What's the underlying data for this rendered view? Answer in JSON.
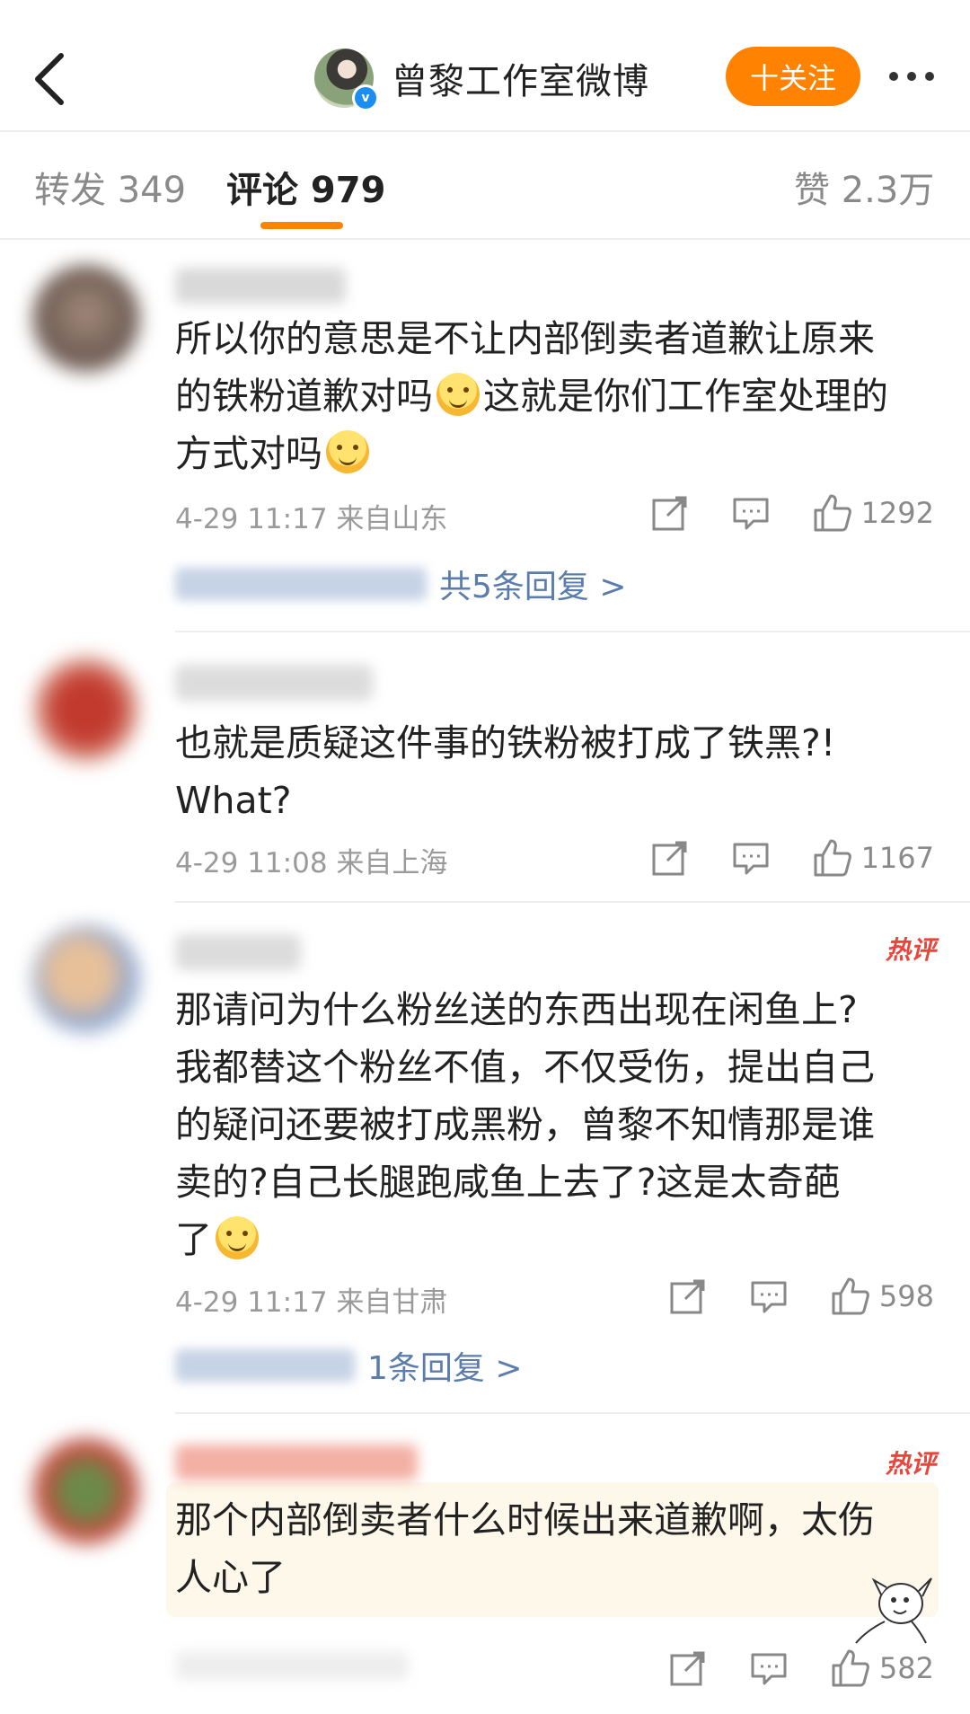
{
  "header": {
    "account_name": "曾黎工作室微博",
    "follow_label": "十关注",
    "verify_mark": "v"
  },
  "tabs": {
    "repost": "转发 349",
    "comments": "评论 979",
    "likes": "赞 2.3万"
  },
  "comments": [
    {
      "text_line1": "所以你的意思是不让内部倒卖者道歉让原来",
      "text_line2a": "的铁粉道歉对吗",
      "text_line2b": "这就是你们工作室处理的",
      "text_line3": "方式对吗",
      "meta": "4-29 11:17 来自山东",
      "likes": "1292",
      "replies": "共5条回复 >"
    },
    {
      "text_line1": "也就是质疑这件事的铁粉被打成了铁黑?!",
      "text_line2": "What?",
      "meta": "4-29 11:08 来自上海",
      "likes": "1167"
    },
    {
      "badge": "热评",
      "text_line1": "那请问为什么粉丝送的东西出现在闲鱼上?",
      "text_line2": "我都替这个粉丝不值，不仅受伤，提出自己",
      "text_line3": "的疑问还要被打成黑粉，曾黎不知情那是谁",
      "text_line4": "卖的?自己长腿跑咸鱼上去了?这是太奇葩",
      "text_line5": "了",
      "meta": "4-29 11:17 来自甘肃",
      "likes": "598",
      "replies": "1条回复 >"
    },
    {
      "badge": "热评",
      "text_line1": "那个内部倒卖者什么时候出来道歉啊，太伤",
      "text_line2": "人心了",
      "likes": "582"
    }
  ],
  "icons": [
    "back-icon",
    "more-icon",
    "repost-icon",
    "comment-icon",
    "like-icon",
    "smile-emoji",
    "sticker"
  ],
  "colors": {
    "accent": "#ff8200",
    "link": "#5b7dad",
    "hot": "#e8453c"
  }
}
